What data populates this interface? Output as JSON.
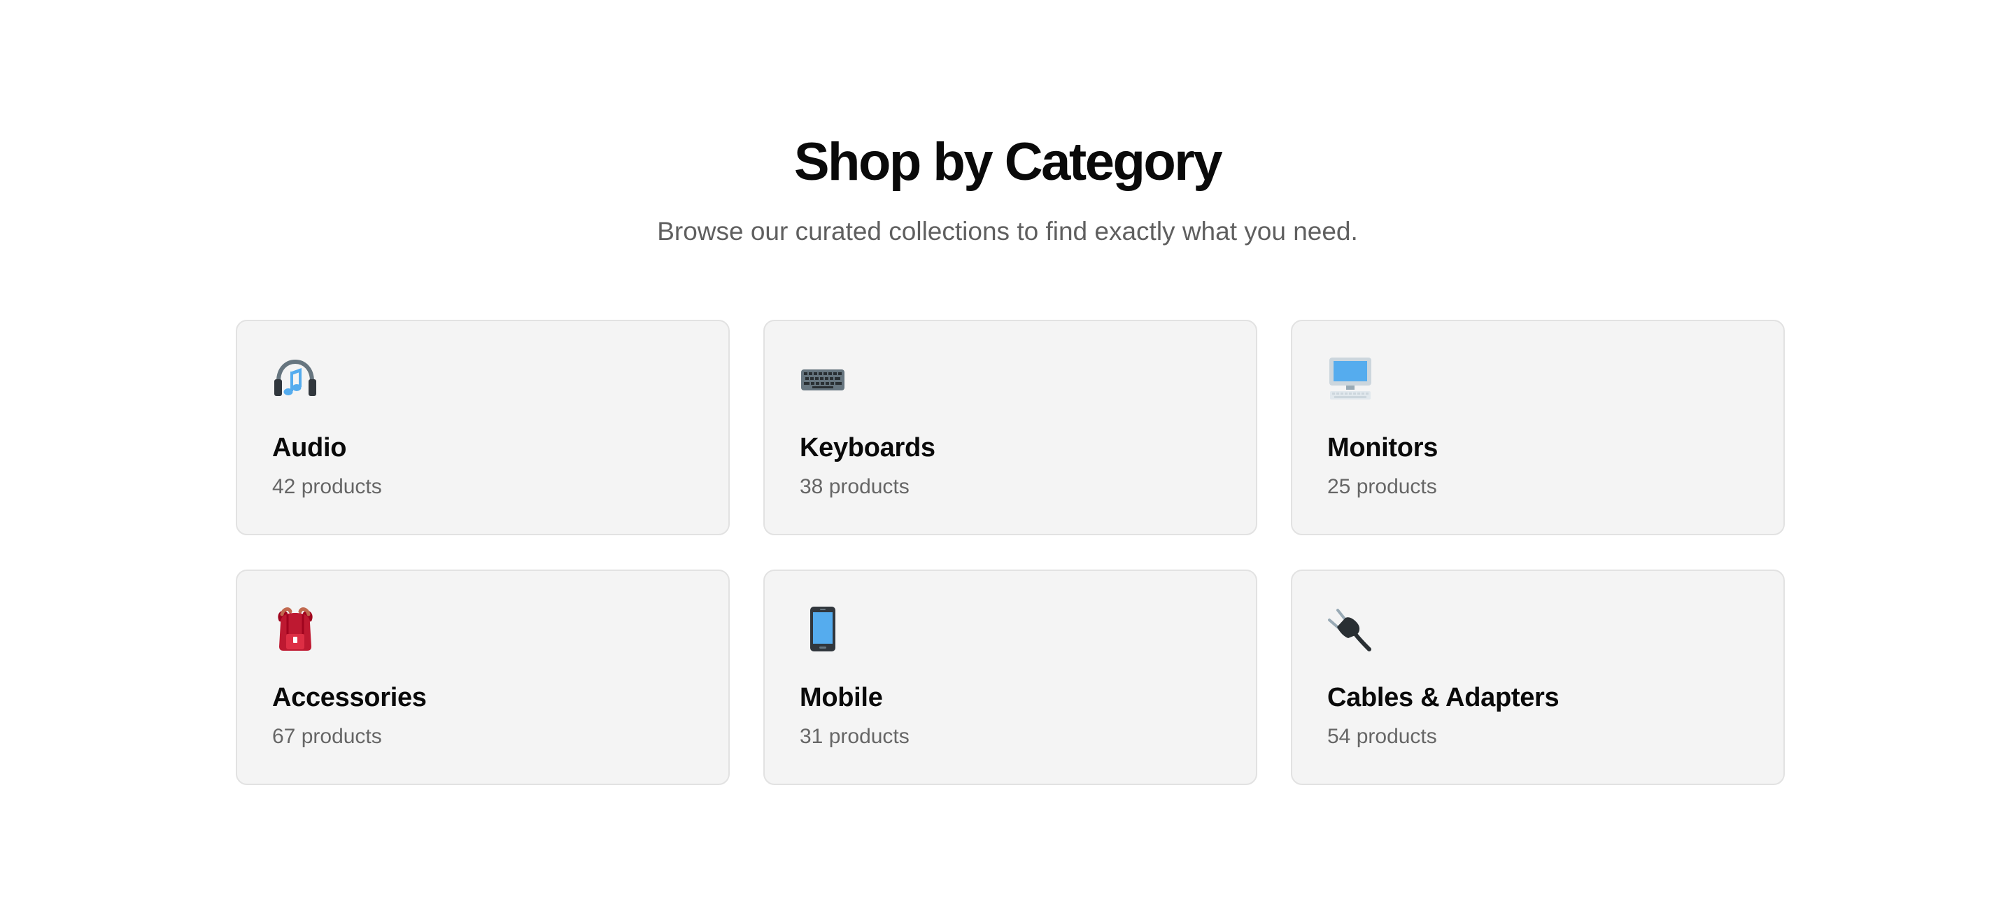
{
  "section": {
    "title": "Shop by Category",
    "subtitle": "Browse our curated collections to find exactly what you need."
  },
  "categories": [
    {
      "name": "Audio",
      "count": "42 products",
      "icon": "headphones-icon"
    },
    {
      "name": "Keyboards",
      "count": "38 products",
      "icon": "keyboard-icon"
    },
    {
      "name": "Monitors",
      "count": "25 products",
      "icon": "monitor-icon"
    },
    {
      "name": "Accessories",
      "count": "67 products",
      "icon": "backpack-icon"
    },
    {
      "name": "Mobile",
      "count": "31 products",
      "icon": "mobile-phone-icon"
    },
    {
      "name": "Cables & Adapters",
      "count": "54 products",
      "icon": "plug-icon"
    }
  ],
  "colors": {
    "card_background": "#f4f4f4",
    "card_border": "#e2e2e2",
    "heading": "#0a0a0a",
    "muted_text": "#666666"
  }
}
